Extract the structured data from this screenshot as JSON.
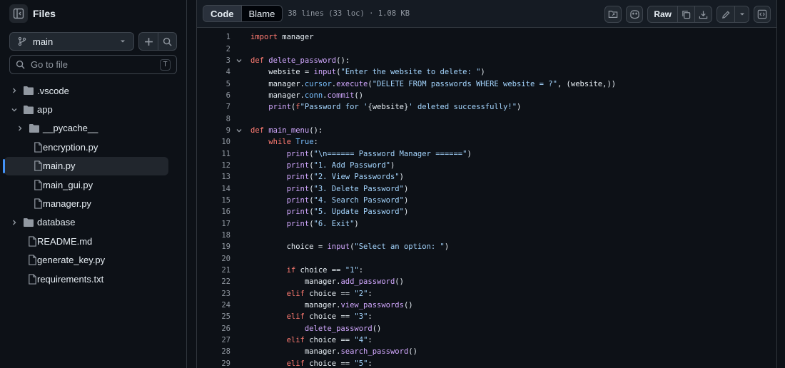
{
  "sidebar": {
    "title": "Files",
    "branch": "main",
    "goto_placeholder": "Go to file",
    "goto_shortcut": "T",
    "tree": [
      {
        "label": ".vscode",
        "type": "folder",
        "depth": 0,
        "expanded": false
      },
      {
        "label": "app",
        "type": "folder",
        "depth": 0,
        "expanded": true
      },
      {
        "label": "__pycache__",
        "type": "folder",
        "depth": 1,
        "expanded": false
      },
      {
        "label": "encryption.py",
        "type": "file",
        "depth": 1
      },
      {
        "label": "main.py",
        "type": "file",
        "depth": 1,
        "selected": true
      },
      {
        "label": "main_gui.py",
        "type": "file",
        "depth": 1
      },
      {
        "label": "manager.py",
        "type": "file",
        "depth": 1
      },
      {
        "label": "database",
        "type": "folder",
        "depth": 0,
        "expanded": false
      },
      {
        "label": "README.md",
        "type": "file",
        "depth": 0
      },
      {
        "label": "generate_key.py",
        "type": "file",
        "depth": 0
      },
      {
        "label": "requirements.txt",
        "type": "file",
        "depth": 0
      }
    ]
  },
  "toolbar": {
    "code_tab": "Code",
    "blame_tab": "Blame",
    "file_info": "38 lines (33 loc) · 1.08 KB",
    "raw_label": "Raw"
  },
  "code": {
    "lines": [
      {
        "n": "1",
        "fold": false,
        "tokens": [
          [
            "kw",
            "import"
          ],
          [
            "",
            "  manager"
          ]
        ]
      },
      {
        "n": "2",
        "fold": false,
        "tokens": []
      },
      {
        "n": "3",
        "fold": true,
        "tokens": [
          [
            "kw",
            "def"
          ],
          [
            "",
            ""
          ],
          [
            "fn",
            "delete_password"
          ],
          [
            "",
            "():"
          ]
        ]
      },
      {
        "n": "4",
        "fold": false,
        "tokens": [
          [
            "",
            "    website = "
          ],
          [
            "fn",
            "input"
          ],
          [
            "",
            "("
          ],
          [
            "st",
            "\"Enter the website to delete: \""
          ],
          [
            "",
            ")"
          ]
        ]
      },
      {
        "n": "5",
        "fold": false,
        "tokens": [
          [
            "",
            "    manager."
          ],
          [
            "pp",
            "cursor"
          ],
          [
            "",
            "."
          ],
          [
            "fn",
            "execute"
          ],
          [
            "",
            "("
          ],
          [
            "st",
            "\"DELETE FROM passwords WHERE website = ?\""
          ],
          [
            "",
            ", (website,))"
          ]
        ]
      },
      {
        "n": "6",
        "fold": false,
        "tokens": [
          [
            "",
            "    manager."
          ],
          [
            "pp",
            "conn"
          ],
          [
            "",
            "."
          ],
          [
            "fn",
            "commit"
          ],
          [
            "",
            "()"
          ]
        ]
      },
      {
        "n": "7",
        "fold": false,
        "tokens": [
          [
            "",
            "    "
          ],
          [
            "fn",
            "print"
          ],
          [
            "",
            "("
          ],
          [
            "kw",
            "f"
          ],
          [
            "st",
            "\"Password for '"
          ],
          [
            "",
            "{website}"
          ],
          [
            "st",
            "' deleted successfully!\""
          ],
          [
            "",
            ")"
          ]
        ]
      },
      {
        "n": "8",
        "fold": false,
        "tokens": []
      },
      {
        "n": "9",
        "fold": true,
        "tokens": [
          [
            "kw",
            "def"
          ],
          [
            "",
            ""
          ],
          [
            "fn",
            "main_menu"
          ],
          [
            "",
            "():"
          ]
        ]
      },
      {
        "n": "10",
        "fold": false,
        "tokens": [
          [
            "",
            "    "
          ],
          [
            "kw",
            "while"
          ],
          [
            "",
            ""
          ],
          [
            "pp",
            "True"
          ],
          [
            "",
            ":"
          ]
        ]
      },
      {
        "n": "11",
        "fold": false,
        "tokens": [
          [
            "",
            "        "
          ],
          [
            "fn",
            "print"
          ],
          [
            "",
            "("
          ],
          [
            "st",
            "\"\\n====== Password Manager ======\""
          ],
          [
            "",
            ")"
          ]
        ]
      },
      {
        "n": "12",
        "fold": false,
        "tokens": [
          [
            "",
            "        "
          ],
          [
            "fn",
            "print"
          ],
          [
            "",
            "("
          ],
          [
            "st",
            "\"1. Add Password\""
          ],
          [
            "",
            ")"
          ]
        ]
      },
      {
        "n": "13",
        "fold": false,
        "tokens": [
          [
            "",
            "        "
          ],
          [
            "fn",
            "print"
          ],
          [
            "",
            "("
          ],
          [
            "st",
            "\"2. View Passwords\""
          ],
          [
            "",
            ")"
          ]
        ]
      },
      {
        "n": "14",
        "fold": false,
        "tokens": [
          [
            "",
            "        "
          ],
          [
            "fn",
            "print"
          ],
          [
            "",
            "("
          ],
          [
            "st",
            "\"3. Delete Password\""
          ],
          [
            "",
            ")"
          ]
        ]
      },
      {
        "n": "15",
        "fold": false,
        "tokens": [
          [
            "",
            "        "
          ],
          [
            "fn",
            "print"
          ],
          [
            "",
            "("
          ],
          [
            "st",
            "\"4. Search Password\""
          ],
          [
            "",
            ")"
          ]
        ]
      },
      {
        "n": "16",
        "fold": false,
        "tokens": [
          [
            "",
            "        "
          ],
          [
            "fn",
            "print"
          ],
          [
            "",
            "("
          ],
          [
            "st",
            "\"5. Update Password\""
          ],
          [
            "",
            ")"
          ]
        ]
      },
      {
        "n": "17",
        "fold": false,
        "tokens": [
          [
            "",
            "        "
          ],
          [
            "fn",
            "print"
          ],
          [
            "",
            "("
          ],
          [
            "st",
            "\"6. Exit\""
          ],
          [
            "",
            ")"
          ]
        ]
      },
      {
        "n": "18",
        "fold": false,
        "tokens": []
      },
      {
        "n": "19",
        "fold": false,
        "tokens": [
          [
            "",
            "        choice = "
          ],
          [
            "fn",
            "input"
          ],
          [
            "",
            "("
          ],
          [
            "st",
            "\"Select an option: \""
          ],
          [
            "",
            ")"
          ]
        ]
      },
      {
        "n": "20",
        "fold": false,
        "tokens": []
      },
      {
        "n": "21",
        "fold": false,
        "tokens": [
          [
            "",
            "        "
          ],
          [
            "kw",
            "if"
          ],
          [
            "",
            "choice == "
          ],
          [
            "st",
            "\"1\""
          ],
          [
            "",
            ":"
          ]
        ]
      },
      {
        "n": "22",
        "fold": false,
        "tokens": [
          [
            "",
            "            manager."
          ],
          [
            "fn",
            "add_password"
          ],
          [
            "",
            "()"
          ]
        ]
      },
      {
        "n": "23",
        "fold": false,
        "tokens": [
          [
            "",
            "        "
          ],
          [
            "kw",
            "elif"
          ],
          [
            "",
            "choice == "
          ],
          [
            "st",
            "\"2\""
          ],
          [
            "",
            ":"
          ]
        ]
      },
      {
        "n": "24",
        "fold": false,
        "tokens": [
          [
            "",
            "            manager."
          ],
          [
            "fn",
            "view_passwords"
          ],
          [
            "",
            "()"
          ]
        ]
      },
      {
        "n": "25",
        "fold": false,
        "tokens": [
          [
            "",
            "        "
          ],
          [
            "kw",
            "elif"
          ],
          [
            "",
            "choice == "
          ],
          [
            "st",
            "\"3\""
          ],
          [
            "",
            ":"
          ]
        ]
      },
      {
        "n": "26",
        "fold": false,
        "tokens": [
          [
            "",
            "            "
          ],
          [
            "fn",
            "delete_password"
          ],
          [
            "",
            "()"
          ]
        ]
      },
      {
        "n": "27",
        "fold": false,
        "tokens": [
          [
            "",
            "        "
          ],
          [
            "kw",
            "elif"
          ],
          [
            "",
            "choice == "
          ],
          [
            "st",
            "\"4\""
          ],
          [
            "",
            ":"
          ]
        ]
      },
      {
        "n": "28",
        "fold": false,
        "tokens": [
          [
            "",
            "            manager."
          ],
          [
            "fn",
            "search_password"
          ],
          [
            "",
            "()"
          ]
        ]
      },
      {
        "n": "29",
        "fold": false,
        "tokens": [
          [
            "",
            "        "
          ],
          [
            "kw",
            "elif"
          ],
          [
            "",
            "choice == "
          ],
          [
            "st",
            "\"5\""
          ],
          [
            "",
            ":"
          ]
        ]
      }
    ]
  }
}
